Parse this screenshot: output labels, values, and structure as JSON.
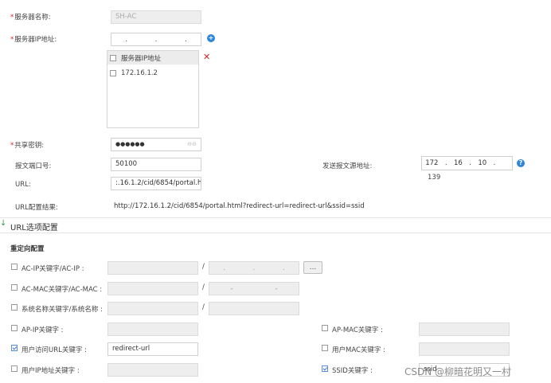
{
  "server": {
    "name_label": "服务器名称:",
    "name_value": "SH-AC",
    "ip_label": "服务器IP地址:",
    "ip_table_header": "服务器IP地址",
    "ip_rows": [
      "172.16.1.2"
    ],
    "secret_label": "共享密钥:",
    "secret_value": "●●●●●●",
    "secret_suffix": "⊖⊖"
  },
  "packet": {
    "port_label": "报文端口号:",
    "port_value": "50100",
    "source_label": "发送报文源地址:",
    "source_ip": [
      "172",
      "16",
      "10",
      ""
    ],
    "source_ip_overflow": "139"
  },
  "url": {
    "label": "URL:",
    "value": ":.16.1.2/cid/6854/portal.html",
    "result_label": "URL配置结果:",
    "result_value": "http://172.16.1.2/cid/6854/portal.html?redirect-url=redirect-url&ssid=ssid"
  },
  "section": {
    "title": "URL选项配置",
    "subtitle": "重定向配置"
  },
  "options": {
    "acip_label": "AC-IP关键字/AC-IP :",
    "acmac_label": "AC-MAC关键字/AC-MAC :",
    "sysname_label": "系统名称关键字/系统名称 :",
    "slash": "/",
    "more_button": "...",
    "apip_label": "AP-IP关键字 :",
    "apmac_label": "AP-MAC关键字 :",
    "userurl_label": "用户访问URL关键字 :",
    "userurl_value": "redirect-url",
    "usermac_label": "用户MAC关键字 :",
    "userip_label": "用户IP地址关键字 :",
    "ssid_label": "SSID关键字 :",
    "ssid_value": "ssid"
  },
  "watermark": "CSDN @柳暗花明又一村",
  "colors": {
    "required": "#e02020",
    "add_icon": "#2f86d8",
    "delete_icon": "#e02020",
    "help_icon": "#2f86d8"
  }
}
